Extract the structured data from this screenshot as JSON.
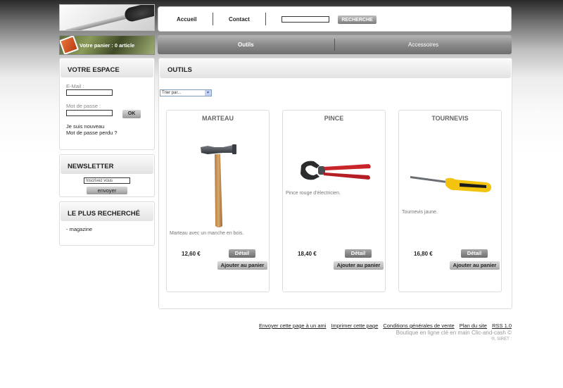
{
  "header": {
    "nav": {
      "home": "Accueil",
      "contact": "Contact"
    },
    "search": {
      "value": "",
      "button": "RECHERCHE"
    }
  },
  "cart": {
    "text": "Votre panier : 0 article"
  },
  "categories": [
    {
      "label": "Outils"
    },
    {
      "label": "Accessoires"
    }
  ],
  "sidebar": {
    "account": {
      "title": "VOTRE ESPACE",
      "email_label": "E-Mail :",
      "password_label": "Mot de passe :",
      "ok_button": "OK",
      "register_link": "Je suis nouveau",
      "forgot_link": "Mot de passe perdu ?"
    },
    "newsletter": {
      "title": "NEWSLETTER",
      "input_value": "Inscrivez vous",
      "button": "envoyer"
    },
    "popular": {
      "title": "LE PLUS RECHERCHÉ",
      "items": [
        "- magazine"
      ]
    }
  },
  "main": {
    "title": "OUTILS",
    "sort": {
      "selected": "Trier par..."
    },
    "products": [
      {
        "name": "MARTEAU",
        "description": "Marteau avec un manche en bois.",
        "price": "12,60 €",
        "detail": "Détail",
        "add": "Ajouter au panier"
      },
      {
        "name": "PINCE",
        "description": "Pince rouge d'électricien.",
        "price": "18,40 €",
        "detail": "Détail",
        "add": "Ajouter au panier"
      },
      {
        "name": "TOURNEVIS",
        "description": "Tournevis jaune.",
        "price": "16,80 €",
        "detail": "Détail",
        "add": "Ajouter au panier"
      }
    ]
  },
  "footer": {
    "links": [
      "Envoyer cette page à un ami",
      "Imprimer cette page",
      "Conditions générales de vente",
      "Plan du site",
      "RSS 1.0"
    ],
    "copyright": "Boutique en ligne clé en main Clic-and-cash ©",
    "siret": "®, SIRET :"
  }
}
